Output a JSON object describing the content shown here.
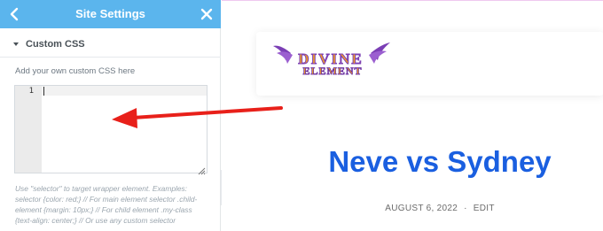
{
  "panel": {
    "title": "Site Settings",
    "section_label": "Custom CSS",
    "help_text": "Add your own custom CSS here",
    "editor": {
      "line_numbers": [
        "1"
      ],
      "content": ""
    },
    "note": "Use \"selector\" to target wrapper element. Examples: selector {color: red;} // For main element selector .child-element {margin: 10px;} // For child element .my-class {text-align: center;} // Or use any custom selector"
  },
  "preview": {
    "logo_text_top": "DIVINE",
    "logo_text_bottom": "ELEMENT",
    "post_title": "Neve vs Sydney",
    "post_date": "AUGUST 6, 2022",
    "post_separator": "·",
    "post_edit": "EDIT"
  },
  "colors": {
    "header_blue": "#5bb5ed",
    "title_blue": "#1a5fe0",
    "arrow_red": "#e8201a",
    "logo_purple": "#7b3fb5",
    "logo_orange": "#f4a020"
  },
  "icons": {
    "back": "chevron-left-icon",
    "close": "close-icon",
    "caret": "caret-down-icon",
    "collapse": "chevron-left-icon",
    "resize": "resize-handle-icon"
  }
}
